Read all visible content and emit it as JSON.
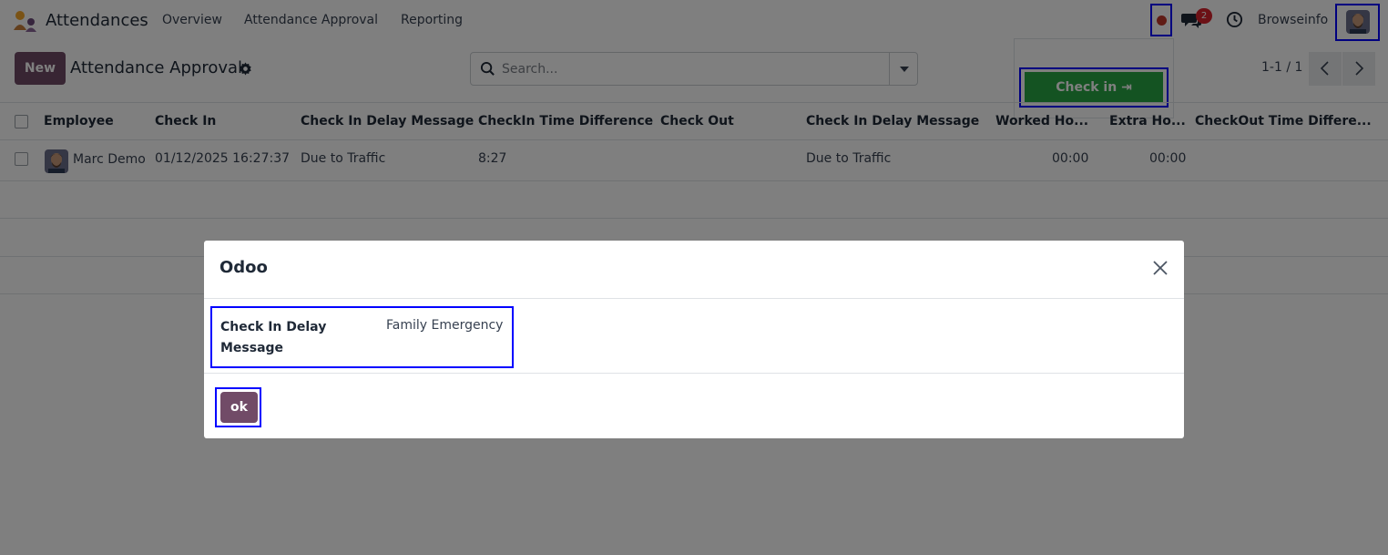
{
  "navbar": {
    "app_name": "Attendances",
    "menu": [
      "Overview",
      "Attendance Approval",
      "Reporting"
    ],
    "chat_badge": "2",
    "user_name": "Browseinfo"
  },
  "control_panel": {
    "new_label": "New",
    "title": "Attendance Approval",
    "search_placeholder": "Search...",
    "pager": "1-1 / 1"
  },
  "checkin_popover": {
    "button_label": "Check in ⇥"
  },
  "table": {
    "columns": [
      "Employee",
      "Check In",
      "Check In Delay Message",
      "CheckIn Time Difference",
      "Check Out",
      "Check In Delay Message",
      "Worked Ho...",
      "Extra Ho...",
      "CheckOut Time Differe..."
    ],
    "rows": [
      {
        "employee": "Marc Demo",
        "check_in": "01/12/2025 16:27:37",
        "check_in_delay_message": "Due to Traffic",
        "checkin_time_difference": "8:27",
        "check_out": "",
        "check_in_delay_message_2": "Due to Traffic",
        "worked_hours": "00:00",
        "extra_hours": "00:00",
        "checkout_time_difference": ""
      }
    ]
  },
  "dialog": {
    "title": "Odoo",
    "field_label": "Check In Delay Message",
    "field_value": "Family Emergency",
    "ok_label": "ok"
  },
  "colors": {
    "primary": "#714b67",
    "success": "#28a745",
    "highlight_border": "#0000ff",
    "status_dot": "#c0392b",
    "badge": "#d9232d"
  }
}
